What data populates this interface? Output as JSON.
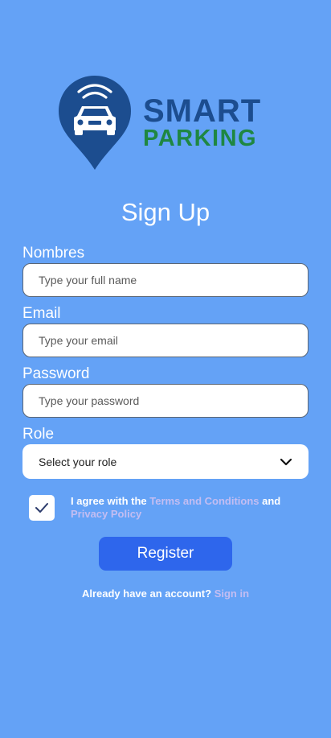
{
  "colors": {
    "background": "#64a2f6",
    "logo_primary": "#1c4d8f",
    "logo_secondary": "#1f8742",
    "button": "#2e66ec",
    "link": "#c3bdf2"
  },
  "logo": {
    "line1": "SMART",
    "line2": "PARKING",
    "icon": "parking-pin-car-icon"
  },
  "title": "Sign Up",
  "fields": {
    "name": {
      "label": "Nombres",
      "placeholder": "Type your full name",
      "value": ""
    },
    "email": {
      "label": "Email",
      "placeholder": "Type your email",
      "value": ""
    },
    "password": {
      "label": "Password",
      "placeholder": "Type your password",
      "value": ""
    },
    "role": {
      "label": "Role",
      "selected": "Select your role",
      "icon": "chevron-down-icon"
    }
  },
  "agreement": {
    "checked": true,
    "prefix": "I agree with the ",
    "terms_link": "Terms and Conditions",
    "middle": " and ",
    "privacy_link": "Privacy Policy"
  },
  "register_button": "Register",
  "signin": {
    "prompt": "Already have an account? ",
    "link": "Sign in"
  }
}
